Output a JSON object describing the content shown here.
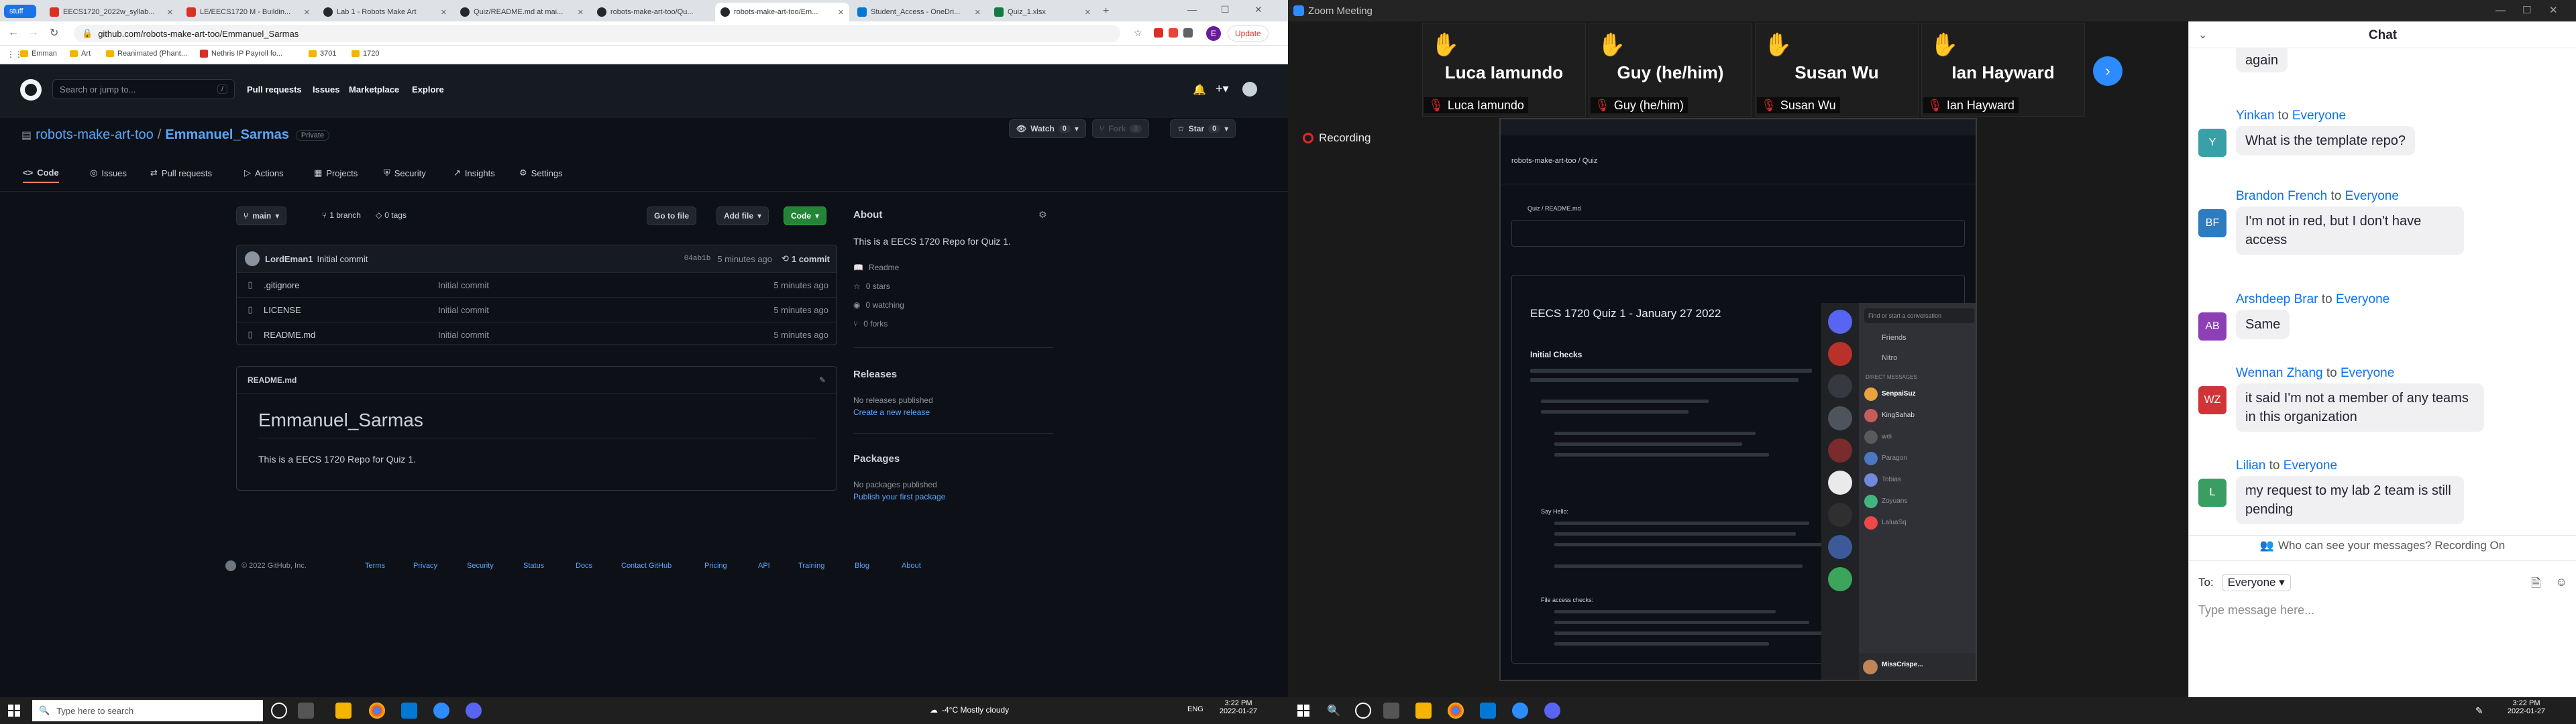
{
  "left_browser": {
    "tabs": [
      {
        "label": "stuff",
        "color": "#1a73e8"
      },
      {
        "label": "EECS1720_2022w_syllab...",
        "color": "#d93025"
      },
      {
        "label": "LE/EECS1720 M - Buildin...",
        "color": "#d93025"
      },
      {
        "label": "Lab 1 - Robots Make Art",
        "color": "#24292f"
      },
      {
        "label": "Quiz/README.md at mai...",
        "color": "#24292f"
      },
      {
        "label": "robots-make-art-too/Qu...",
        "color": "#24292f"
      },
      {
        "label": "robots-make-art-too/Em...",
        "color": "#24292f"
      },
      {
        "label": "Student_Access - OneDri...",
        "color": "#0078d4"
      },
      {
        "label": "Quiz_1.xlsx",
        "color": "#107c41"
      }
    ],
    "url": "github.com/robots-make-art-too/Emmanuel_Sarmas",
    "update_label": "Update",
    "bookmarks": [
      "Emman",
      "Art",
      "Reanimated (Phant...",
      "Nethris IP Payroll fo...",
      "3701",
      "1720"
    ]
  },
  "github": {
    "search_placeholder": "Search or jump to...",
    "search_key": "/",
    "nav": [
      "Pull requests",
      "Issues",
      "Marketplace",
      "Explore"
    ],
    "owner": "robots-make-art-too",
    "repo": "Emmanuel_Sarmas",
    "visibility": "Private",
    "watch_label": "Watch",
    "watch_count": "0",
    "fork_label": "Fork",
    "fork_count": "0",
    "star_label": "Star",
    "star_count": "0",
    "repo_tabs": [
      "Code",
      "Issues",
      "Pull requests",
      "Actions",
      "Projects",
      "Security",
      "Insights",
      "Settings"
    ],
    "branch": "main",
    "branches": "1 branch",
    "tags": "0 tags",
    "goto_file": "Go to file",
    "add_file": "Add file",
    "code_btn": "Code",
    "commit_author": "LordEman1",
    "commit_msg": "Initial commit",
    "commit_hash": "04ab1b",
    "commit_time": "5 minutes ago",
    "commit_count": "1 commit",
    "files": [
      {
        "name": ".gitignore",
        "msg": "Initial commit",
        "time": "5 minutes ago"
      },
      {
        "name": "LICENSE",
        "msg": "Initial commit",
        "time": "5 minutes ago"
      },
      {
        "name": "README.md",
        "msg": "Initial commit",
        "time": "5 minutes ago"
      }
    ],
    "readme_file": "README.md",
    "readme_title": "Emmanuel_Sarmas",
    "readme_body": "This is a EECS 1720 Repo for Quiz 1.",
    "about_title": "About",
    "about_desc": "This is a EECS 1720 Repo for Quiz 1.",
    "about_items": [
      "Readme",
      "0 stars",
      "0 watching",
      "0 forks"
    ],
    "releases_title": "Releases",
    "releases_none": "No releases published",
    "releases_link": "Create a new release",
    "packages_title": "Packages",
    "packages_none": "No packages published",
    "packages_link": "Publish your first package",
    "footer_copy": "© 2022 GitHub, Inc.",
    "footer_links": [
      "Terms",
      "Privacy",
      "Security",
      "Status",
      "Docs",
      "Contact GitHub",
      "Pricing",
      "API",
      "Training",
      "Blog",
      "About"
    ]
  },
  "taskbar_left": {
    "search_placeholder": "Type here to search",
    "weather": "-4°C  Mostly cloudy",
    "lang": "ENG",
    "time": "3:22 PM",
    "date": "2022-01-27"
  },
  "zoom": {
    "title": "Zoom Meeting",
    "recording": "Recording",
    "participants": [
      {
        "big": "Luca Iamundo",
        "small": "Luca Iamundo"
      },
      {
        "big": "Guy (he/him)",
        "small": "Guy (he/him)"
      },
      {
        "big": "Susan Wu",
        "small": "Susan Wu"
      },
      {
        "big": "Ian Hayward",
        "small": "Ian Hayward"
      }
    ],
    "chat_title": "Chat",
    "chat_partial": "again",
    "messages": [
      {
        "from": "Yinkan",
        "to": "Everyone",
        "text": "What is the template repo?",
        "initials": "Y",
        "color": "#3aa0a8"
      },
      {
        "from": "Brandon French",
        "to": "Everyone",
        "text": "I'm not in red, but I don't have access",
        "initials": "BF",
        "color": "#2e7bbf"
      },
      {
        "from": "Arshdeep Brar",
        "to": "Everyone",
        "text": "Same",
        "initials": "AB",
        "color": "#8d3fb5"
      },
      {
        "from": "Wennan Zhang",
        "to": "Everyone",
        "text": "it said I'm not a member of any teams in this organization",
        "initials": "WZ",
        "color": "#d13438"
      },
      {
        "from": "Lilian",
        "to": "Everyone",
        "text": "my request to my lab 2 team is still pending",
        "initials": "L",
        "color": "#3a9e63"
      }
    ],
    "to_word": "to",
    "who_can_see": "Who can see your messages? Recording On",
    "to_label": "To:",
    "to_value": "Everyone",
    "input_placeholder": "Type message here...",
    "time": "3:22 PM",
    "date": "2022-01-27"
  },
  "shared": {
    "repo_path": "robots-make-art-too / Quiz",
    "file_path": "Quiz / README.md",
    "doc_title": "EECS 1720 Quiz 1 - January 27 2022",
    "section1": "Initial Checks",
    "section2": "Say Hello:",
    "section3": "File access checks:",
    "discord_search": "Find or start a conversation",
    "discord_items": [
      "Friends",
      "Nitro"
    ],
    "dm_header": "DIRECT MESSAGES",
    "dms": [
      "SenpaiSuz",
      "KingSahab",
      "wei",
      "Paragon",
      "Tobias",
      "Zoyuans",
      "LaluaSq",
      "MissCrispe..."
    ]
  }
}
